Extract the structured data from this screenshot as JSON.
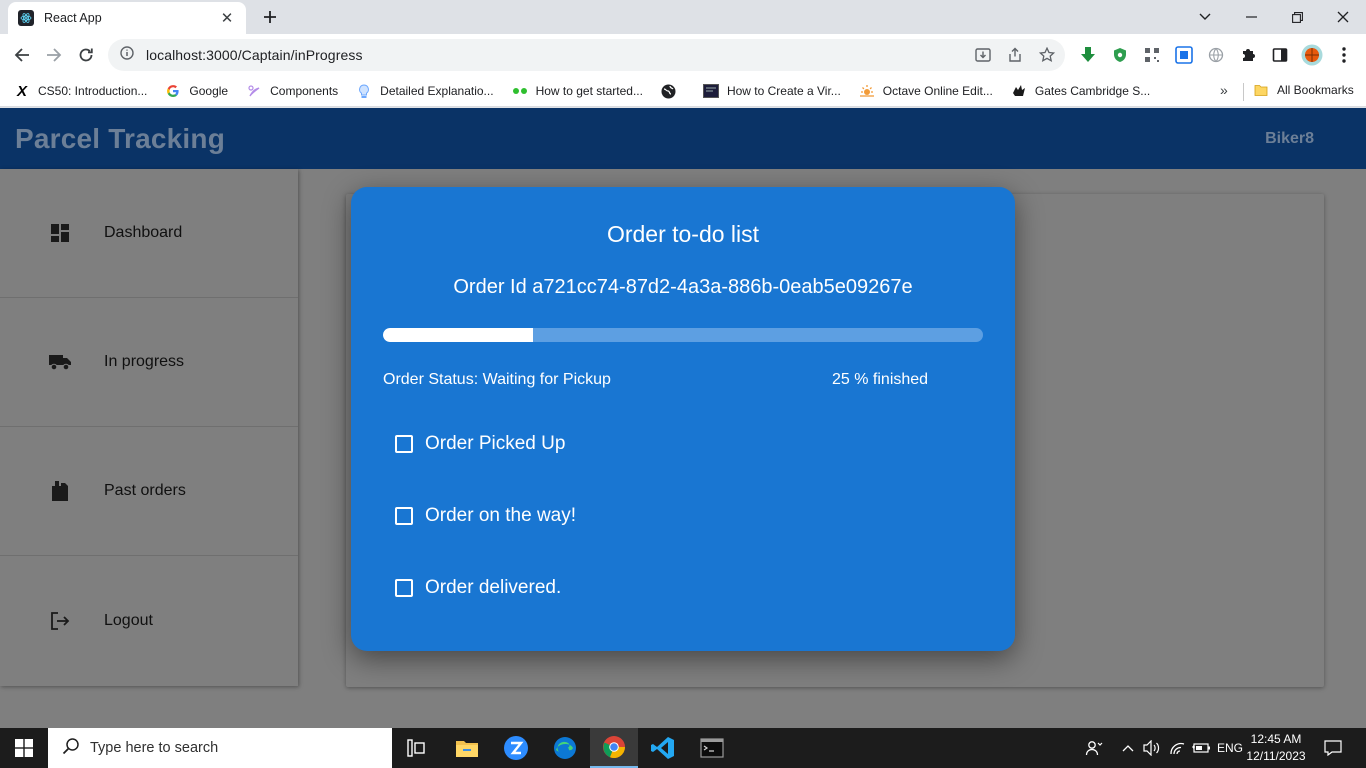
{
  "browser": {
    "tab_title": "React App",
    "url": "localhost:3000/Captain/inProgress",
    "bookmarks": [
      {
        "label": "CS50: Introduction...",
        "icon": "cs50-icon"
      },
      {
        "label": "Google",
        "icon": "google-icon"
      },
      {
        "label": "Components",
        "icon": "components-icon"
      },
      {
        "label": "Detailed Explanatio...",
        "icon": "bulb-icon"
      },
      {
        "label": "How to get started...",
        "icon": "dots-icon"
      },
      {
        "label": "",
        "icon": "globe-icon"
      },
      {
        "label": "How to Create a Vir...",
        "icon": "video-icon"
      },
      {
        "label": "Octave Online Edit...",
        "icon": "octave-icon"
      },
      {
        "label": "Gates Cambridge S...",
        "icon": "gates-icon"
      }
    ],
    "all_bookmarks": "All Bookmarks",
    "more": "»"
  },
  "app": {
    "brand": "Parcel Tracking",
    "user": "Biker8",
    "sidebar": [
      {
        "label": "Dashboard",
        "icon": "dashboard-icon"
      },
      {
        "label": "In progress",
        "icon": "truck-icon"
      },
      {
        "label": "Past orders",
        "icon": "package-icon"
      },
      {
        "label": "Logout",
        "icon": "logout-icon"
      }
    ]
  },
  "modal": {
    "title": "Order to-do list",
    "order_id": "Order Id a721cc74-87d2-4a3a-886b-0eab5e09267e",
    "progress_percent": 25,
    "status": "Order Status: Waiting for Pickup",
    "finished": "25 % finished",
    "tasks": [
      {
        "label": "Order Picked Up",
        "checked": false
      },
      {
        "label": "Order on the way!",
        "checked": false
      },
      {
        "label": "Order delivered.",
        "checked": false
      }
    ]
  },
  "taskbar": {
    "search_placeholder": "Type here to search",
    "language": "ENG",
    "time": "12:45 AM",
    "date": "12/11/2023"
  },
  "colors": {
    "header": "#0a3366",
    "modal": "#1976d2",
    "overlay": "#7f7f7f",
    "progress_fill": "#ffffff",
    "progress_track": "#5d9fe2"
  }
}
